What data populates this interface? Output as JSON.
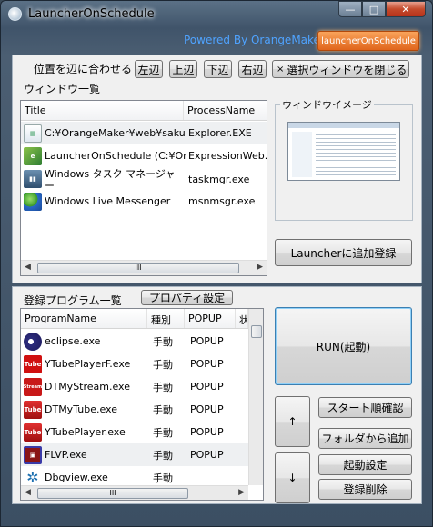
{
  "window": {
    "title": "LauncherOnSchedule",
    "caption": {
      "minimize": "—",
      "maximize": "□",
      "close": "✕"
    }
  },
  "header": {
    "powered_link": "Powered By OrangeMaker",
    "brand_button": "launcherOnSchedule"
  },
  "top_panel": {
    "align_label": "位置を辺に合わせる",
    "align_buttons": [
      "左辺",
      "上辺",
      "下辺",
      "右辺"
    ],
    "close_selected": "選択ウィンドウを閉じる",
    "close_icon": "×",
    "window_list_label": "ウィンドウ一覧",
    "columns": [
      "Title",
      "ProcessName"
    ],
    "rows": [
      {
        "title": "C:¥OrangeMaker¥web¥saku...",
        "process": "Explorer.EXE",
        "icon": "folder-icon",
        "selected": true
      },
      {
        "title": "LauncherOnSchedule (C:¥Or...",
        "process": "ExpressionWeb...",
        "icon": "expression-web-icon",
        "selected": false
      },
      {
        "title": "Windows タスク マネージャ",
        "title2": "ー",
        "process": "taskmgr.exe",
        "icon": "task-manager-icon",
        "selected": false
      },
      {
        "title": "Windows Live Messenger",
        "process": "msnmsgr.exe",
        "icon": "messenger-icon",
        "selected": false
      }
    ],
    "scroll_thumb": "III",
    "preview_label": "ウィンドウイメージ",
    "add_launcher_button": "Launcherに追加登録"
  },
  "bottom_panel": {
    "programs_label": "登録プログラム一覧",
    "properties_button": "プロパティ設定",
    "columns": [
      "ProgramName",
      "種別",
      "POPUP",
      "状"
    ],
    "rows": [
      {
        "name": "eclipse.exe",
        "kind": "手動",
        "popup": "POPUP",
        "icon": "eclipse-icon",
        "selected": false
      },
      {
        "name": "YTubePlayerF.exe",
        "kind": "手動",
        "popup": "POPUP",
        "icon": "youtube-icon",
        "selected": false
      },
      {
        "name": "DTMyStream.exe",
        "kind": "手動",
        "popup": "POPUP",
        "icon": "stream-icon",
        "selected": false
      },
      {
        "name": "DTMyTube.exe",
        "kind": "手動",
        "popup": "POPUP",
        "icon": "tube-icon",
        "selected": false
      },
      {
        "name": "YTubePlayer.exe",
        "kind": "手動",
        "popup": "POPUP",
        "icon": "tube-icon",
        "selected": false
      },
      {
        "name": "FLVP.exe",
        "kind": "手動",
        "popup": "POPUP",
        "icon": "flv-icon",
        "selected": true
      },
      {
        "name": "Dbgview.exe",
        "kind": "手動",
        "popup": "",
        "icon": "bug-icon",
        "selected": false
      }
    ],
    "scroll_thumb": "III",
    "run_button": "RUN(起動)",
    "up_button": "↑",
    "down_button": "↓",
    "startup_order_button": "スタート順確認",
    "add_from_folder_button": "フォルダから追加",
    "startup_settings_button": "起動設定",
    "delete_button": "登録削除"
  },
  "colors": {
    "link": "#4fa3ff",
    "brand": "#e86f24",
    "frame": "#40546a"
  }
}
